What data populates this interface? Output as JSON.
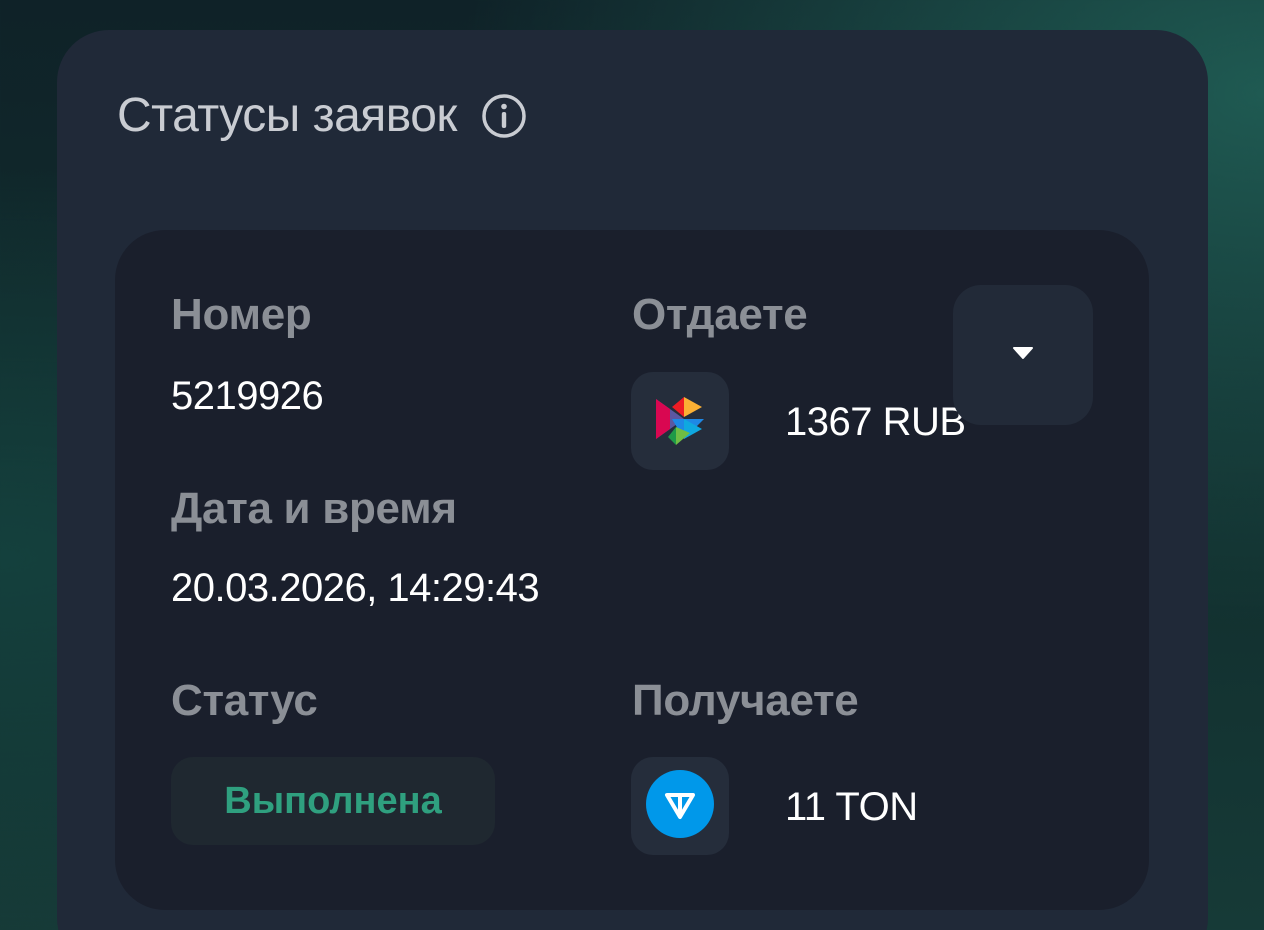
{
  "panel": {
    "title": "Статусы заявок",
    "info_icon": "info-circle-icon"
  },
  "order": {
    "number_label": "Номер",
    "number_value": "5219926",
    "datetime_label": "Дата и время",
    "datetime_value": "20.03.2026, 14:29:43",
    "status_label": "Статус",
    "status_value": "Выполнена",
    "give_label": "Отдаете",
    "give_amount": "1367 RUB",
    "give_icon": "sbp-logo-icon",
    "receive_label": "Получаете",
    "receive_amount": "11 TON",
    "receive_icon": "ton-logo-icon",
    "expand_icon": "chevron-down-icon"
  },
  "colors": {
    "panel_bg": "#202938",
    "card_bg": "#1a1f2c",
    "label": "#8b8f96",
    "value": "#ffffff",
    "status_green": "#2fa07f",
    "ton_blue": "#0098ea"
  }
}
